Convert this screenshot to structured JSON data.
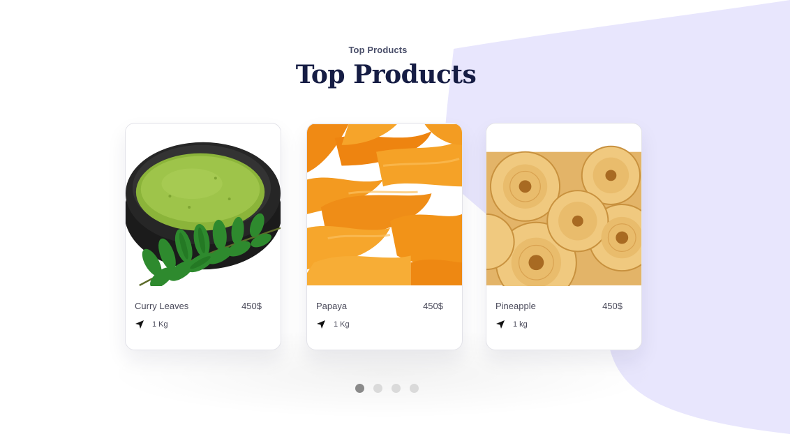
{
  "colors": {
    "background": "#ffffff",
    "blob": "#e8e6fd",
    "heading": "#161d44",
    "text": "#4a4a5a",
    "dot_active": "#8a8a8a",
    "dot_inactive": "#dadada"
  },
  "section": {
    "eyebrow": "Top Products",
    "title": "Top Products"
  },
  "products": [
    {
      "name": "Curry Leaves",
      "price": "450$",
      "weight": "1 Kg",
      "image": "green-powder-with-curry-leaves"
    },
    {
      "name": "Papaya",
      "price": "450$",
      "weight": "1 Kg",
      "image": "dried-papaya-slices"
    },
    {
      "name": "Pineapple",
      "price": "450$",
      "weight": "1 kg",
      "image": "dried-pineapple-rings"
    }
  ],
  "icons": {
    "weight": "navigation-arrow-icon"
  },
  "carousel": {
    "page_count": 4,
    "active_index": 0
  }
}
